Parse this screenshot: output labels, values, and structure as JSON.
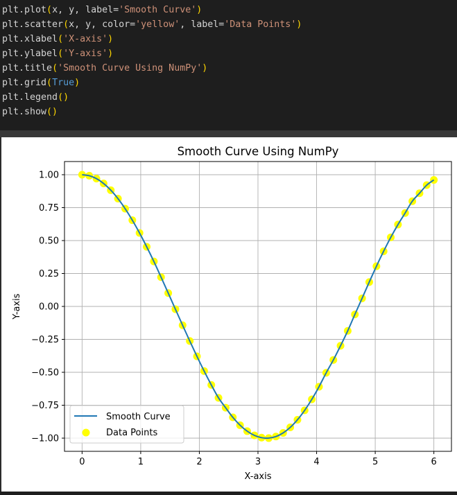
{
  "code_cell": {
    "lines": [
      [
        {
          "t": "plt.plot",
          "c": ""
        },
        {
          "t": "(",
          "c": "paren"
        },
        {
          "t": "x, y, label=",
          "c": ""
        },
        {
          "t": "'Smooth Curve'",
          "c": "str"
        },
        {
          "t": ")",
          "c": "paren"
        }
      ],
      [
        {
          "t": "plt.scatter",
          "c": ""
        },
        {
          "t": "(",
          "c": "paren"
        },
        {
          "t": "x, y, color=",
          "c": ""
        },
        {
          "t": "'yellow'",
          "c": "str"
        },
        {
          "t": ", label=",
          "c": ""
        },
        {
          "t": "'Data Points'",
          "c": "str"
        },
        {
          "t": ")",
          "c": "paren"
        }
      ],
      [
        {
          "t": "plt.xlabel",
          "c": ""
        },
        {
          "t": "(",
          "c": "paren"
        },
        {
          "t": "'X-axis'",
          "c": "str"
        },
        {
          "t": ")",
          "c": "paren"
        }
      ],
      [
        {
          "t": "plt.ylabel",
          "c": ""
        },
        {
          "t": "(",
          "c": "paren"
        },
        {
          "t": "'Y-axis'",
          "c": "str"
        },
        {
          "t": ")",
          "c": "paren"
        }
      ],
      [
        {
          "t": "plt.title",
          "c": ""
        },
        {
          "t": "(",
          "c": "paren"
        },
        {
          "t": "'Smooth Curve Using NumPy'",
          "c": "str"
        },
        {
          "t": ")",
          "c": "paren"
        }
      ],
      [
        {
          "t": "plt.grid",
          "c": ""
        },
        {
          "t": "(",
          "c": "paren"
        },
        {
          "t": "True",
          "c": "kw"
        },
        {
          "t": ")",
          "c": "paren"
        }
      ],
      [
        {
          "t": "plt.legend",
          "c": ""
        },
        {
          "t": "()",
          "c": "paren"
        }
      ],
      [
        {
          "t": "plt.show",
          "c": ""
        },
        {
          "t": "()",
          "c": "paren"
        }
      ]
    ]
  },
  "chart_data": {
    "type": "line",
    "title": "Smooth Curve Using NumPy",
    "xlabel": "X-axis",
    "ylabel": "Y-axis",
    "xlim": [
      -0.3,
      6.3
    ],
    "ylim": [
      -1.1,
      1.1
    ],
    "xticks": [
      0,
      1,
      2,
      3,
      4,
      5,
      6
    ],
    "xtick_labels": [
      "0",
      "1",
      "2",
      "3",
      "4",
      "5",
      "6"
    ],
    "yticks": [
      1.0,
      0.75,
      0.5,
      0.25,
      0.0,
      -0.25,
      -0.5,
      -0.75,
      -1.0
    ],
    "ytick_labels": [
      "1.00",
      "0.75",
      "0.50",
      "0.25",
      "0.00",
      "−0.25",
      "−0.50",
      "−0.75",
      "−1.00"
    ],
    "grid": true,
    "legend_position": "lower-left",
    "series": [
      {
        "name": "Smooth Curve",
        "kind": "line",
        "color": "#1f77b4",
        "x": [
          0,
          0.1224,
          0.2449,
          0.3673,
          0.4898,
          0.6122,
          0.7347,
          0.8571,
          0.9796,
          1.102,
          1.2245,
          1.3469,
          1.4694,
          1.5918,
          1.7143,
          1.8367,
          1.9592,
          2.0816,
          2.2041,
          2.3265,
          2.449,
          2.5714,
          2.6939,
          2.8163,
          2.9388,
          3.0612,
          3.1837,
          3.3061,
          3.4286,
          3.551,
          3.6735,
          3.7959,
          3.9184,
          4.0408,
          4.1633,
          4.2857,
          4.4082,
          4.5306,
          4.6531,
          4.7755,
          4.898,
          5.0204,
          5.1429,
          5.2653,
          5.3878,
          5.5102,
          5.6327,
          5.7551,
          5.8776,
          6.0
        ],
        "y": [
          1.0,
          0.9925,
          0.9702,
          0.9333,
          0.8824,
          0.8183,
          0.7419,
          0.6546,
          0.5577,
          0.4526,
          0.3412,
          0.2224,
          0.1012,
          -0.021,
          -0.1427,
          -0.2625,
          -0.3789,
          -0.4905,
          -0.5959,
          -0.6939,
          -0.7693,
          -0.8422,
          -0.9017,
          -0.947,
          -0.9789,
          -0.9963,
          -0.9996,
          -0.9877,
          -0.9606,
          -0.918,
          -0.8603,
          -0.789,
          -0.7052,
          -0.6097,
          -0.5042,
          -0.4063,
          -0.2986,
          -0.1857,
          -0.0606,
          0.0615,
          0.1851,
          0.305,
          0.4185,
          0.5246,
          0.6214,
          0.7092,
          0.7989,
          0.8593,
          0.9208,
          0.9602
        ]
      },
      {
        "name": "Data Points",
        "kind": "scatter",
        "color": "#ffff00",
        "x_ref": "same as Smooth Curve",
        "y_ref": "same as Smooth Curve"
      }
    ]
  }
}
